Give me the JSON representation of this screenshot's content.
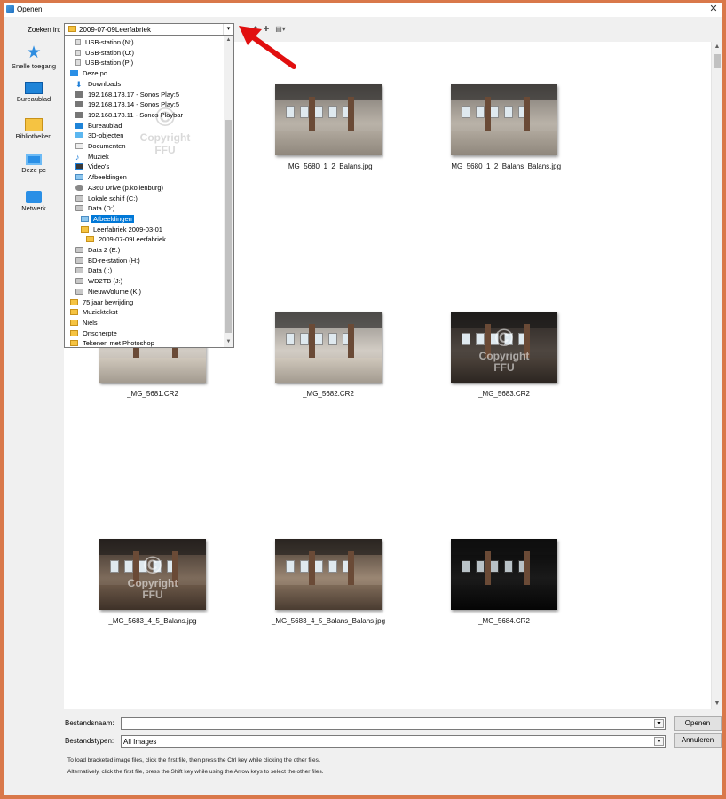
{
  "window": {
    "title": "Openen",
    "close_glyph": "✕"
  },
  "lookin": {
    "label": "Zoeken in:",
    "current": "2009-07-09Leerfabriek",
    "dropdown_glyph": "▾"
  },
  "toolbar": {
    "back_glyph": "←",
    "up_glyph": "⬆",
    "newfolder_glyph": "✚",
    "view_glyph": "▤▾"
  },
  "places": [
    {
      "label": "Snelle toegang",
      "icon": "star-icon"
    },
    {
      "label": "Bureaublad",
      "icon": "desktop-icon"
    },
    {
      "label": "Bibliotheken",
      "icon": "libraries-icon"
    },
    {
      "label": "Deze pc",
      "icon": "this-pc-icon"
    },
    {
      "label": "Netwerk",
      "icon": "network-icon"
    }
  ],
  "dropdown": {
    "items": [
      {
        "label": "USB-station (N:)",
        "icon": "usb"
      },
      {
        "label": "USB-station (O:)",
        "icon": "usb"
      },
      {
        "label": "USB-station (P:)",
        "icon": "usb"
      },
      {
        "label": "Deze pc",
        "icon": "pc"
      },
      {
        "label": "Downloads",
        "icon": "down"
      },
      {
        "label": "192.168.178.17 - Sonos Play:5",
        "icon": "dev"
      },
      {
        "label": "192.168.178.14 - Sonos Play:5",
        "icon": "dev"
      },
      {
        "label": "192.168.178.11 - Sonos Playbar",
        "icon": "dev"
      },
      {
        "label": "Bureaublad",
        "icon": "desk"
      },
      {
        "label": "3D-objecten",
        "icon": "3d"
      },
      {
        "label": "Documenten",
        "icon": "doc"
      },
      {
        "label": "Muziek",
        "icon": "music"
      },
      {
        "label": "Video's",
        "icon": "video"
      },
      {
        "label": "Afbeeldingen",
        "icon": "pic"
      },
      {
        "label": "A360 Drive (p.kollenburg)",
        "icon": "cloud"
      },
      {
        "label": "Lokale schijf (C:)",
        "icon": "drive"
      },
      {
        "label": "Data (D:)",
        "icon": "drive"
      },
      {
        "label": "Afbeeldingen",
        "icon": "pic",
        "selected": true
      },
      {
        "label": "Leerfabriek 2009-03-01",
        "icon": "folder"
      },
      {
        "label": "2009-07-09Leerfabriek",
        "icon": "folder"
      },
      {
        "label": "Data 2 (E:)",
        "icon": "drive"
      },
      {
        "label": "BD-re-station (H:)",
        "icon": "drive"
      },
      {
        "label": "Data (I:)",
        "icon": "drive"
      },
      {
        "label": "WD2TB (J:)",
        "icon": "drive"
      },
      {
        "label": "NieuwVolume (K:)",
        "icon": "drive"
      },
      {
        "label": "75 jaar bevrijding",
        "icon": "folder"
      },
      {
        "label": "Muziektekst",
        "icon": "folder"
      },
      {
        "label": "Niels",
        "icon": "folder"
      },
      {
        "label": "Onscherpte",
        "icon": "folder"
      },
      {
        "label": "Tekenen met Photoshop",
        "icon": "folder"
      }
    ]
  },
  "watermark": {
    "symbol": "©",
    "line1": "Copyright",
    "line2": "FFU"
  },
  "files": [
    {
      "name": "_MG_5680_1_2_Balans.jpg",
      "style": "img-a",
      "watermark": false
    },
    {
      "name": "_MG_5680_1_2_Balans_Balans.jpg",
      "style": "img-a",
      "watermark": false
    },
    {
      "name": "_MG_5681.CR2",
      "style": "img-b",
      "watermark": false
    },
    {
      "name": "_MG_5682.CR2",
      "style": "img-b",
      "watermark": false
    },
    {
      "name": "_MG_5683.CR2",
      "style": "img-c",
      "watermark": true
    },
    {
      "name": "_MG_5683_4_5_Balans.jpg",
      "style": "img-d",
      "watermark": true
    },
    {
      "name": "_MG_5683_4_5_Balans_Balans.jpg",
      "style": "img-e",
      "watermark": false
    },
    {
      "name": "_MG_5684.CR2",
      "style": "img-f",
      "watermark": false
    }
  ],
  "filename": {
    "label": "Bestandsnaam:",
    "value": ""
  },
  "filetype": {
    "label": "Bestandstypen:",
    "value": "All Images"
  },
  "buttons": {
    "open": "Openen",
    "cancel": "Annuleren"
  },
  "hints": [
    "To load bracketed image files, click the first file, then press the Ctrl key while clicking the other files.",
    "Alternatively, click the first file, press the Shift key while using the Arrow keys to select the other files."
  ]
}
